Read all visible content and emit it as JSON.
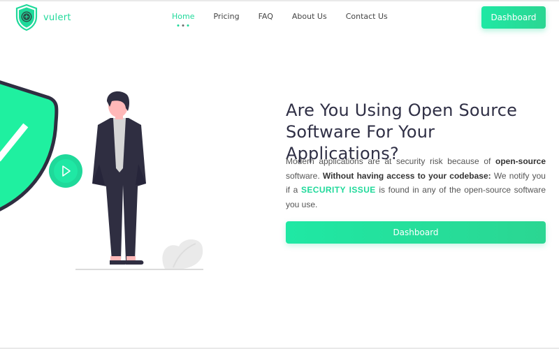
{
  "header": {
    "logo_text": "vulert",
    "nav": [
      {
        "label": "Home",
        "active": true
      },
      {
        "label": "Pricing"
      },
      {
        "label": "FAQ"
      },
      {
        "label": "About Us"
      },
      {
        "label": "Contact Us"
      }
    ],
    "dashboard_label": "Dashboard"
  },
  "hero": {
    "title_line1": "Are You Using Open Source",
    "title_line2": "Software For Your Applications?",
    "desc_part1": "Modern applications are at security risk because of ",
    "desc_bold1": "open-source",
    "desc_part2": " software. ",
    "desc_bold2": "Without having access to your codebase:",
    "desc_part3": " We notify you if a ",
    "desc_highlight": "SECURITY ISSUE",
    "desc_part4": " is found in any of the open-source software you use.",
    "cta_label": "Dashboard"
  },
  "icons": {
    "logo": "shield-logo-icon",
    "play": "play-icon",
    "shield": "shield-icon"
  },
  "colors": {
    "accent": "#1fd99a",
    "title": "#2f2f45",
    "suit": "#2f2e41",
    "skin": "#ffb8b8"
  }
}
